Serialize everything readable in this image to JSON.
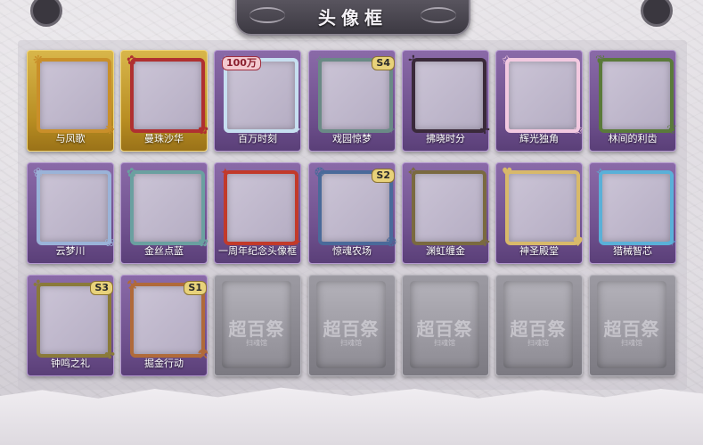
{
  "header": {
    "title": "头像框"
  },
  "frames": [
    {
      "label": "与凤歌",
      "style": "gold",
      "border": "#c98f2a",
      "deco": "❋"
    },
    {
      "label": "曼珠沙华",
      "style": "gold",
      "border": "#b03030",
      "deco": "✿"
    },
    {
      "label": "百万时刻",
      "style": "purple",
      "border": "#c7dff0",
      "deco": "✦",
      "badge": "100万",
      "badge_style": "big"
    },
    {
      "label": "戏园惊梦",
      "style": "purple",
      "border": "#6a8a86",
      "deco": "✧",
      "badge": "S4"
    },
    {
      "label": "拂晓时分",
      "style": "purple",
      "border": "#3a2a3a",
      "deco": "✢"
    },
    {
      "label": "辉光独角",
      "style": "purple",
      "border": "#f2c9e0",
      "deco": "✩"
    },
    {
      "label": "林间的利齿",
      "style": "purple",
      "border": "#5a7a3a",
      "deco": "❦"
    },
    {
      "label": "云梦川",
      "style": "purple",
      "border": "#9ab3d8",
      "deco": "❀"
    },
    {
      "label": "金丝点蓝",
      "style": "purple",
      "border": "#6aa0a0",
      "deco": "✿"
    },
    {
      "label": "一周年纪念头像框",
      "style": "purple",
      "border": "#c23a2a",
      "deco": "✦"
    },
    {
      "label": "惊魂农场",
      "style": "purple",
      "border": "#4a6a9a",
      "deco": "❂",
      "badge": "S2"
    },
    {
      "label": "渊虹缠金",
      "style": "purple",
      "border": "#7a6a40",
      "deco": "✥"
    },
    {
      "label": "神圣殿堂",
      "style": "purple",
      "border": "#d8b96a",
      "deco": "♥"
    },
    {
      "label": "猎械智芯",
      "style": "purple",
      "border": "#5ab0d8",
      "deco": "✧"
    },
    {
      "label": "钟鸣之礼",
      "style": "purple",
      "border": "#8a7a3a",
      "deco": "✤",
      "badge": "S3"
    },
    {
      "label": "掘金行动",
      "style": "purple",
      "border": "#b06a3a",
      "deco": "⚒",
      "badge": "S1"
    }
  ],
  "locked": [
    {
      "text": "超百祭",
      "sub": "扫魂馆"
    },
    {
      "text": "超百祭",
      "sub": "扫魂馆"
    },
    {
      "text": "超百祭",
      "sub": "扫魂馆"
    },
    {
      "text": "超百祭",
      "sub": "扫魂馆"
    },
    {
      "text": "超百祭",
      "sub": "扫魂馆"
    }
  ]
}
